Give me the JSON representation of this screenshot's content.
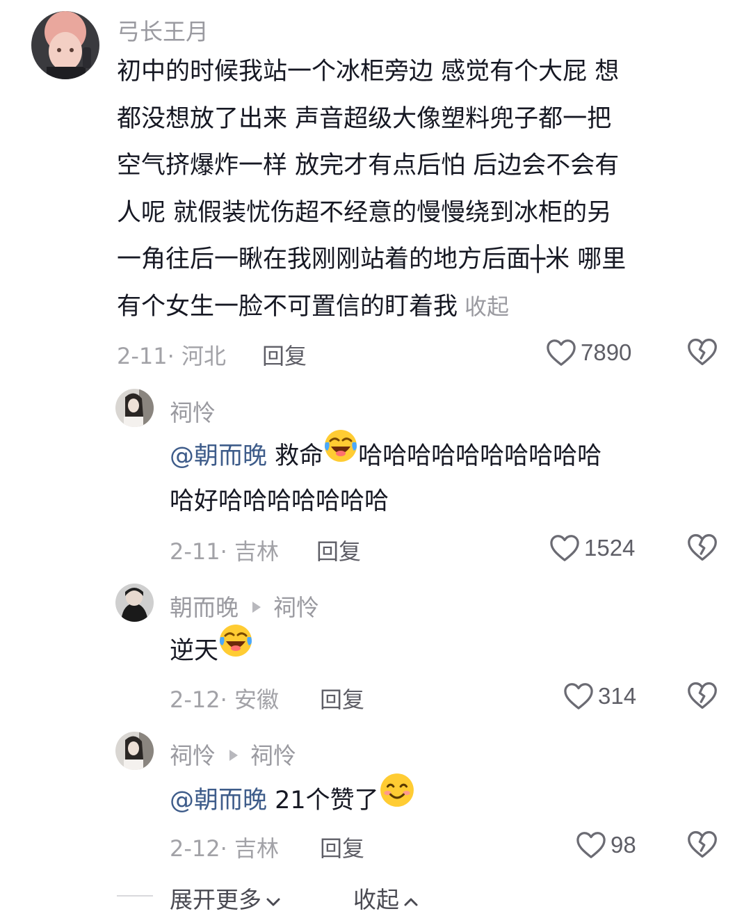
{
  "comments": [
    {
      "username": "弓长王月",
      "lines": [
        "初中的时候我站一个冰柜旁边  感觉有个大屁 想",
        "都没想放了出来  声音超级大像塑料兜子都一把",
        "空气挤爆炸一样  放完才有点后怕  后边会不会有",
        "人呢  就假装忧伤超不经意的慢慢绕到冰柜的另",
        "一角往后一瞅在我刚刚站着的地方后面┼米 哪里",
        "有个女生一脸不可置信的盯着我"
      ],
      "collapse_label": "收起",
      "date_location": "2-11· 河北",
      "reply_label": "回复",
      "likes": "7890"
    },
    {
      "username": "祠怜",
      "mention": "@朝而晚",
      "text_before_emoji": " 救命",
      "emoji": "laughing-crying-emoji",
      "text_after_emoji": "哈哈哈哈哈哈哈哈哈哈",
      "text_line2": "哈好哈哈哈哈哈哈哈",
      "date_location": "2-11· 吉林",
      "reply_label": "回复",
      "likes": "1524"
    },
    {
      "username": "朝而晚",
      "reply_to": "祠怜",
      "text": "逆天",
      "emoji": "laughing-crying-emoji",
      "date_location": "2-12· 安徽",
      "reply_label": "回复",
      "likes": "314"
    },
    {
      "username": "祠怜",
      "reply_to": "祠怜",
      "mention": "@朝而晚",
      "text": " 21个赞了",
      "emoji": "smiling-emoji",
      "date_location": "2-12· 吉林",
      "reply_label": "回复",
      "likes": "98"
    }
  ],
  "footer": {
    "expand_label": "展开更多",
    "collapse_label": "收起"
  },
  "colors": {
    "text": "#161823",
    "meta": "#a2a2a7",
    "mention": "#3e5c8a",
    "icon": "#6b6b73"
  }
}
